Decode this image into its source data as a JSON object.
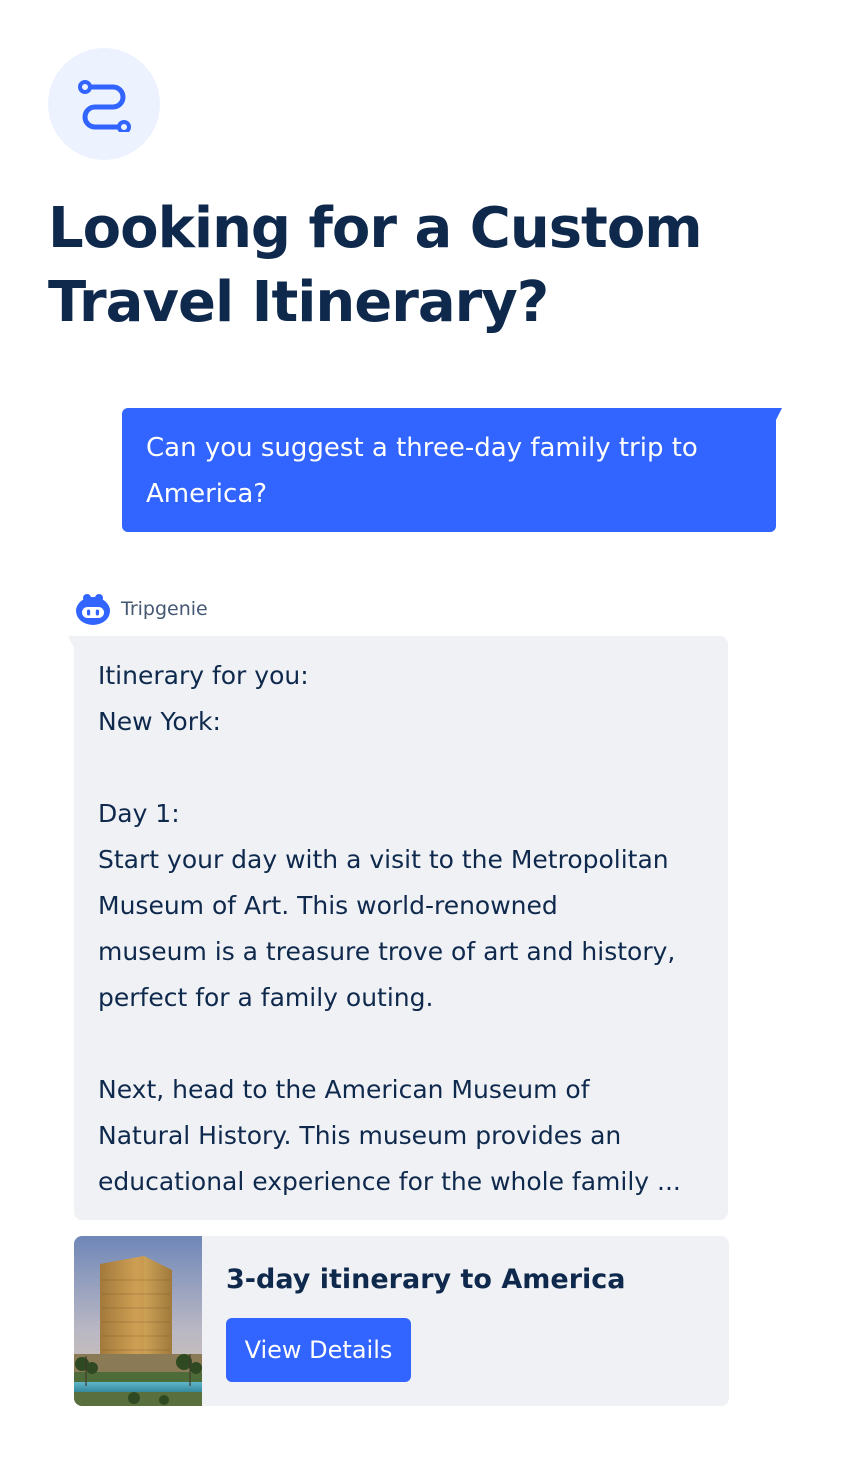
{
  "header": {
    "logo_icon": "route-icon",
    "title_line_1": "Looking for a Custom",
    "title_line_2": "Travel Itinerary?"
  },
  "user_message": {
    "line_1": "Can you suggest a three-day family trip to",
    "line_2": "America?"
  },
  "bot": {
    "avatar_icon": "robot-icon",
    "name": "Tripgenie",
    "lines": [
      "Itinerary for you:",
      "New York:",
      "",
      "Day 1:",
      "Start your day with a visit to the Metropolitan",
      "Museum of Art. This world-renowned",
      "museum is a treasure trove of art and history,",
      "perfect for a family outing.",
      "",
      "Next, head to the American Museum of",
      "Natural History. This museum provides an",
      "educational experience for the whole family ..."
    ]
  },
  "itinerary_card": {
    "title": "3-day itinerary to America",
    "button_label": "View Details",
    "image": "hotel-photo"
  },
  "colors": {
    "accent": "#3264ff",
    "heading": "#0f294d",
    "bubble_bg": "#eff1f5",
    "logo_bg": "#edf3fe"
  }
}
